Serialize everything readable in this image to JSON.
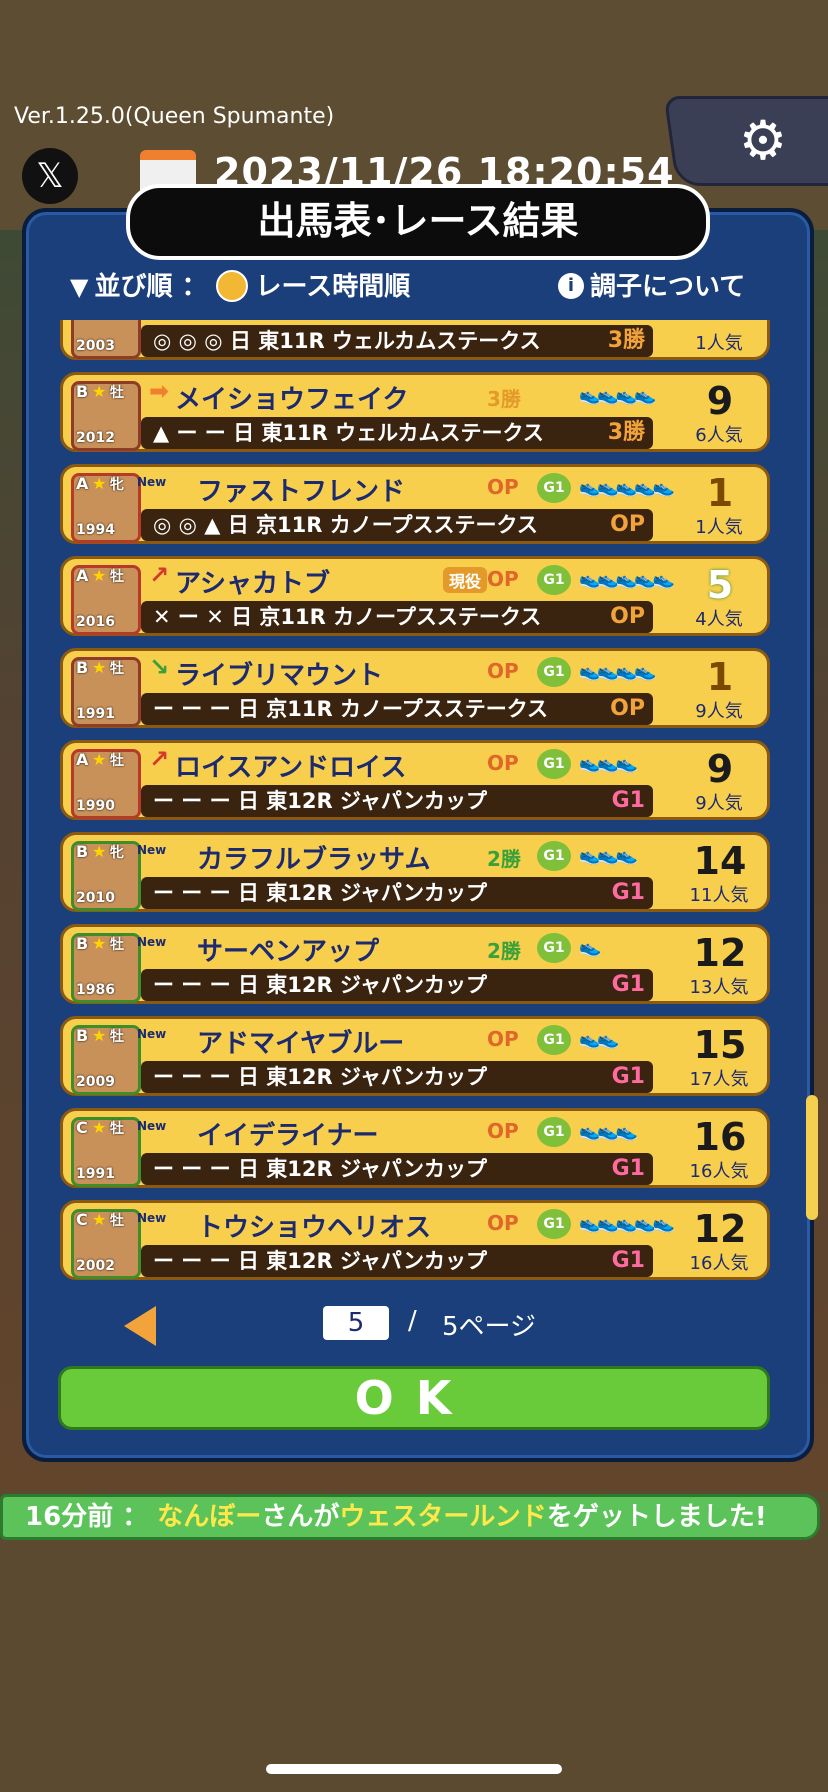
{
  "header": {
    "version": "Ver.1.25.0(Queen Spumante)",
    "x_label": "𝕏",
    "datetime": "2023/11/26 18:20:54",
    "gear": "⚙"
  },
  "modal": {
    "title": "出馬表･レース結果",
    "sort_label": "並び順 ：",
    "sort_value": "レース時間順",
    "about_label": "調子について",
    "info_glyph": "i"
  },
  "rows": [
    {
      "grade": "",
      "sex": "",
      "year": "2003",
      "name": "",
      "race": "◎ ◎ ◎ 日 東11R ウェルカムステークス",
      "badge": "3勝",
      "rank": "",
      "pop": "1人気"
    },
    {
      "grade": "B",
      "sex": "牡",
      "year": "2012",
      "arrow": "➡",
      "name": "メイショウフェイク",
      "cls": "3勝",
      "shoes": "👟👟👟👟",
      "race": "▲ ー ー 日 東11R ウェルカムステークス",
      "badge": "3勝",
      "rank": "9",
      "pop": "6人気"
    },
    {
      "grade": "A",
      "sex": "牝",
      "year": "1994",
      "new": "New",
      "name": "ファストフレンド",
      "cls": "OP",
      "g1": "G1",
      "shoes": "👟👟👟👟👟",
      "race": "◎ ◎ ▲ 日 京11R カノープスステークス",
      "badge": "OP",
      "rank": "1",
      "pop": "1人気"
    },
    {
      "grade": "A",
      "sex": "牡",
      "year": "2016",
      "arrow": "↗",
      "name": "アシャカトブ",
      "genyaku": "現役",
      "cls": "OP",
      "g1": "G1",
      "shoes": "👟👟👟👟👟",
      "race": "✕ ー ✕ 日 京11R カノープスステークス",
      "badge": "OP",
      "rank": "5",
      "pop": "4人気"
    },
    {
      "grade": "B",
      "sex": "牡",
      "year": "1991",
      "arrow": "↘",
      "name": "ライブリマウント",
      "cls": "OP",
      "g1": "G1",
      "shoes": "👟👟👟👟",
      "race": "ー ー ー 日 京11R カノープスステークス",
      "badge": "OP",
      "rank": "1",
      "pop": "9人気"
    },
    {
      "grade": "A",
      "sex": "牡",
      "year": "1990",
      "arrow": "↗",
      "name": "ロイスアンドロイス",
      "cls": "OP",
      "g1": "G1",
      "shoes": "👟👟👟",
      "race": "ー ー ー 日 東12R ジャパンカップ",
      "badge": "G1",
      "rank": "9",
      "pop": "9人気"
    },
    {
      "grade": "B",
      "sex": "牝",
      "year": "2010",
      "new": "New",
      "name": "カラフルブラッサム",
      "cls": "2勝",
      "g1": "G1",
      "shoes": "👟👟👟",
      "race": "ー ー ー 日 東12R ジャパンカップ",
      "badge": "G1",
      "rank": "14",
      "pop": "11人気"
    },
    {
      "grade": "B",
      "sex": "牡",
      "year": "1986",
      "new": "New",
      "name": "サーペンアップ",
      "cls": "2勝",
      "g1": "G1",
      "shoes": "👟",
      "race": "ー ー ー 日 東12R ジャパンカップ",
      "badge": "G1",
      "rank": "12",
      "pop": "13人気"
    },
    {
      "grade": "B",
      "sex": "牡",
      "year": "2009",
      "new": "New",
      "name": "アドマイヤブルー",
      "cls": "OP",
      "g1": "G1",
      "shoes": "👟👟",
      "race": "ー ー ー 日 東12R ジャパンカップ",
      "badge": "G1",
      "rank": "15",
      "pop": "17人気"
    },
    {
      "grade": "C",
      "sex": "牡",
      "year": "1991",
      "new": "New",
      "name": "イイデライナー",
      "cls": "OP",
      "g1": "G1",
      "shoes": "👟👟👟",
      "race": "ー ー ー 日 東12R ジャパンカップ",
      "badge": "G1",
      "rank": "16",
      "pop": "16人気"
    },
    {
      "grade": "C",
      "sex": "牡",
      "year": "2002",
      "new": "New",
      "name": "トウショウヘリオス",
      "cls": "OP",
      "g1": "G1",
      "shoes": "👟👟👟👟👟",
      "race": "ー ー ー 日 東12R ジャパンカップ",
      "badge": "G1",
      "rank": "12",
      "pop": "16人気"
    }
  ],
  "pager": {
    "current": "5",
    "separator": "/",
    "total": "5ページ"
  },
  "ok_label": "OK",
  "ticker": {
    "time": "16分前 ： ",
    "user": "なんぼー",
    "mid": "さんが",
    "item": "ウェスタールンド",
    "end": "をゲットしました!"
  }
}
